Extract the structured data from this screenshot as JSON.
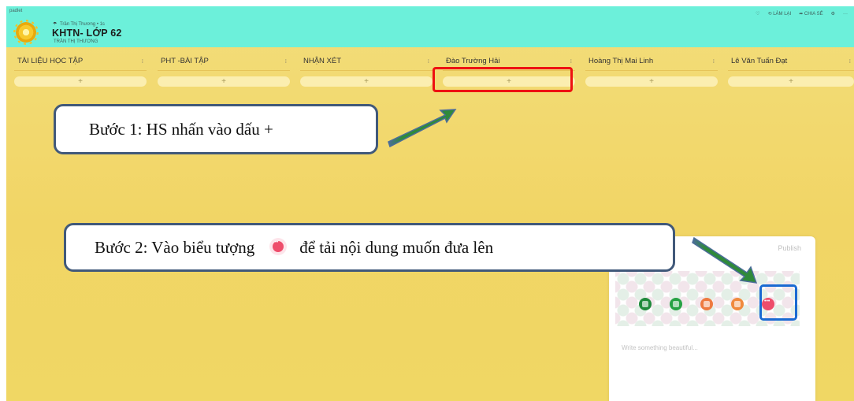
{
  "app": {
    "brand": "padlet",
    "author": "Trần Thị Thương",
    "author_time": "• 1s",
    "title": "KHTN- LỚP 62",
    "subtitle": "TRẦN THỊ THƯƠNG",
    "actions": {
      "remake": "LÀM LẠI",
      "share": "CHIA SẺ",
      "more": "···"
    }
  },
  "columns": [
    {
      "title": "TÀI LIỆU HỌC TẬP",
      "menu": "⁝",
      "add": "+"
    },
    {
      "title": "PHT -BÀI TẬP",
      "menu": "⁝",
      "add": "+"
    },
    {
      "title": "NHẬN XÉT",
      "menu": "⁝",
      "add": "+"
    },
    {
      "title": "Đào Trường Hải",
      "menu": "⁝",
      "add": "+"
    },
    {
      "title": "Hoàng Thị Mai Linh",
      "menu": "⁝",
      "add": "+"
    },
    {
      "title": "Lê Văn Tuấn Đạt",
      "menu": "⁝",
      "add": "+"
    }
  ],
  "callouts": {
    "step1": "Bước 1: HS nhấn vào dấu +",
    "step2_before": "Bước 2: Vào biểu tượng",
    "step2_after": "để tải nội dung muốn đưa lên"
  },
  "panel": {
    "publish": "Publish",
    "placeholder": "Write something beautiful...",
    "tools": [
      "camera-icon",
      "image-icon",
      "link-icon",
      "video-icon",
      "more-icon"
    ]
  },
  "colors": {
    "topbar": "#6cf0da",
    "board": "#f1d565",
    "highlight_red": "#e11111",
    "highlight_blue": "#1a6ad2",
    "arrow_green": "#2f8a3a",
    "callout_border": "#41597a"
  }
}
